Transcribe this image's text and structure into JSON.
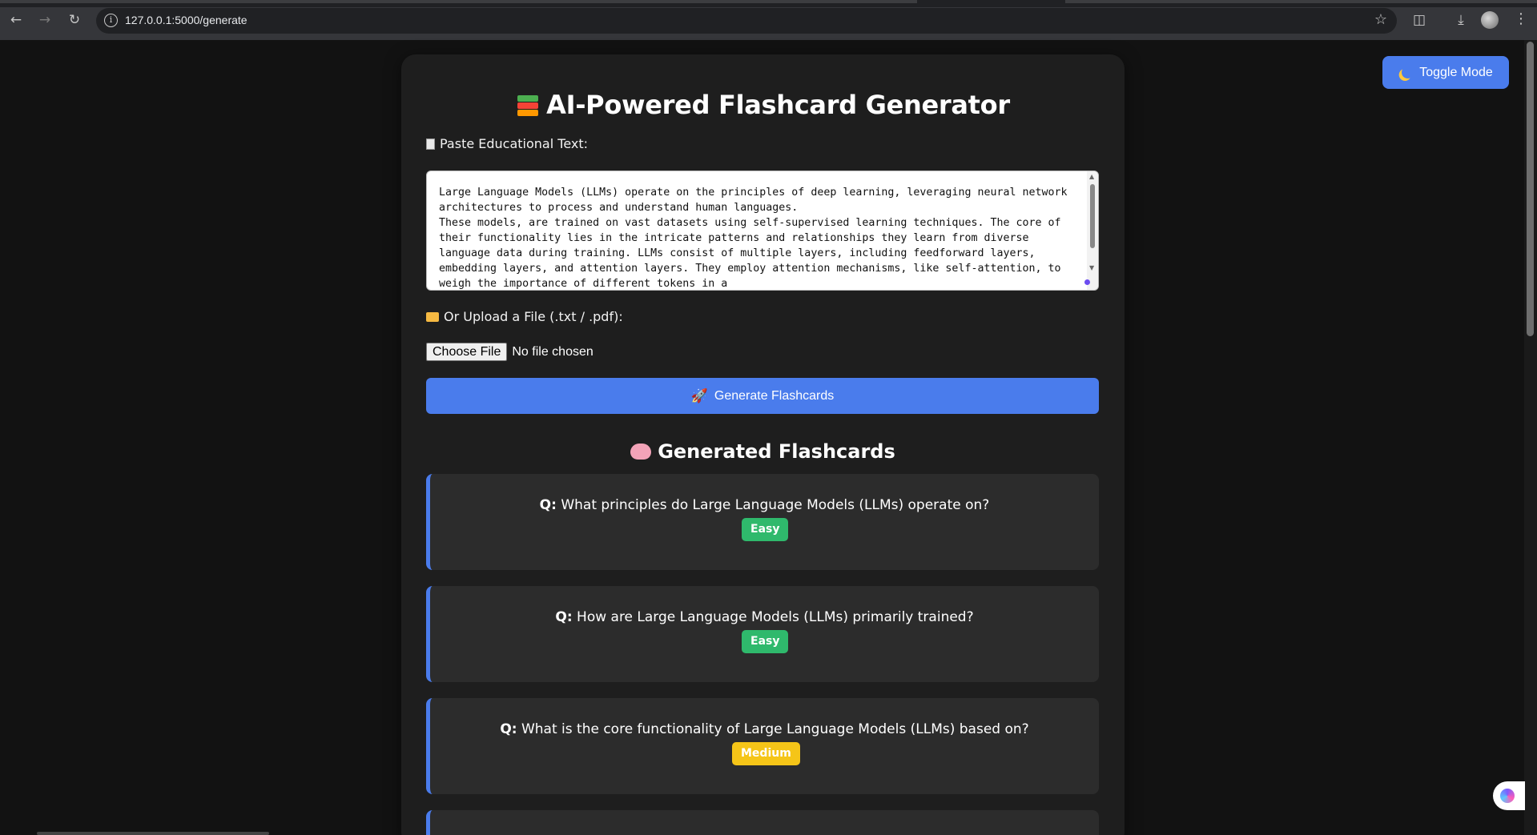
{
  "browser": {
    "url": "127.0.0.1:5000/generate"
  },
  "toggle": {
    "label": "Toggle Mode"
  },
  "app": {
    "title": "AI-Powered Flashcard Generator",
    "paste_label": "Paste Educational Text:",
    "text_value": "Large Language Models (LLMs) operate on the principles of deep learning, leveraging neural network architectures to process and understand human languages.\nThese models, are trained on vast datasets using self-supervised learning techniques. The core of their functionality lies in the intricate patterns and relationships they learn from diverse language data during training. LLMs consist of multiple layers, including feedforward layers, embedding layers, and attention layers. They employ attention mechanisms, like self-attention, to weigh the importance of different tokens in a",
    "upload_label": "Or Upload a File (.txt / .pdf):",
    "choose_file": "Choose File",
    "no_file": "No file chosen",
    "generate_label": "Generate Flashcards",
    "generated_title": "Generated Flashcards"
  },
  "cards": [
    {
      "q_prefix": "Q:",
      "question": "What principles do Large Language Models (LLMs) operate on?",
      "difficulty": "Easy"
    },
    {
      "q_prefix": "Q:",
      "question": "How are Large Language Models (LLMs) primarily trained?",
      "difficulty": "Easy"
    },
    {
      "q_prefix": "Q:",
      "question": "What is the core functionality of Large Language Models (LLMs) based on?",
      "difficulty": "Medium"
    }
  ],
  "colors": {
    "accent": "#4a7cec",
    "easy": "#2fb96c",
    "medium": "#f5c518",
    "background": "#121212",
    "panel": "#1e1e1e",
    "card": "#2c2c2c"
  },
  "icons": {
    "back": "arrow-left-icon",
    "forward": "arrow-right-icon",
    "reload": "reload-icon",
    "bookmark": "star-icon",
    "extensions": "puzzle-icon",
    "downloads": "download-icon",
    "title_emoji": "books-icon",
    "paste_emoji": "clipboard-icon",
    "upload_emoji": "folder-icon",
    "generate_emoji": "rocket-icon",
    "generated_emoji": "brain-icon",
    "toggle_emoji": "moon-icon"
  }
}
